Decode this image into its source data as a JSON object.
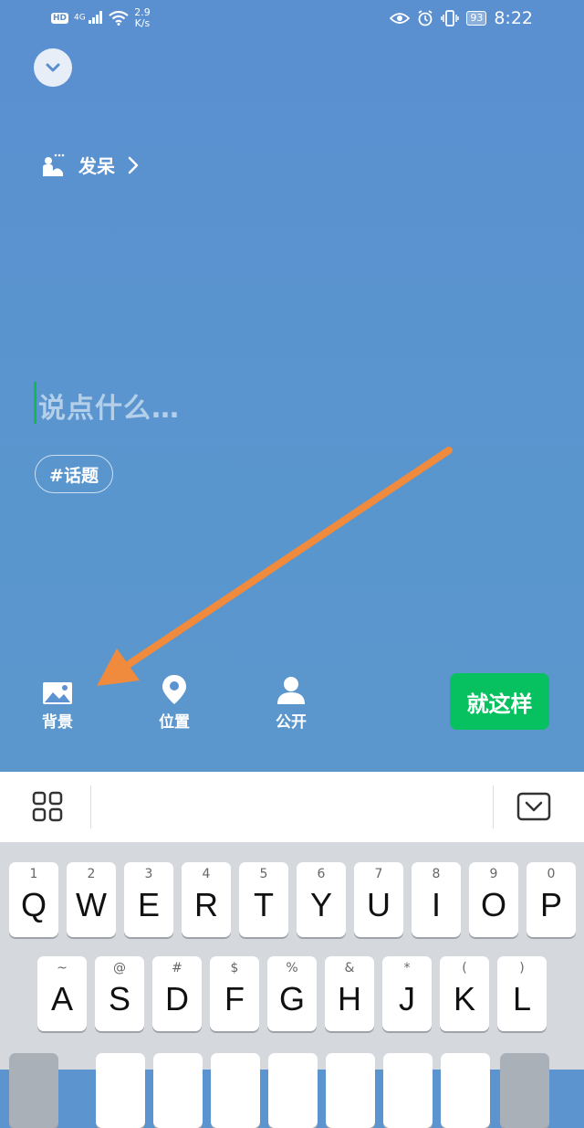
{
  "status_bar": {
    "network_badge": "HD",
    "network_type": "4G",
    "speed_value": "2.9",
    "speed_unit": "K/s",
    "battery": "93",
    "time": "8:22"
  },
  "header": {
    "collapse_icon": "chevron-down-icon"
  },
  "mood": {
    "label": "发呆",
    "icon": "person-daze-icon"
  },
  "composer": {
    "placeholder": "说点什么…",
    "topic_label": "#话题"
  },
  "toolbar": {
    "background_label": "背景",
    "location_label": "位置",
    "visibility_label": "公开",
    "submit_label": "就这样"
  },
  "keyboard": {
    "row1": [
      {
        "sub": "1",
        "main": "Q"
      },
      {
        "sub": "2",
        "main": "W"
      },
      {
        "sub": "3",
        "main": "E"
      },
      {
        "sub": "4",
        "main": "R"
      },
      {
        "sub": "5",
        "main": "T"
      },
      {
        "sub": "6",
        "main": "Y"
      },
      {
        "sub": "7",
        "main": "U"
      },
      {
        "sub": "8",
        "main": "I"
      },
      {
        "sub": "9",
        "main": "O"
      },
      {
        "sub": "0",
        "main": "P"
      }
    ],
    "row2": [
      {
        "sub": "~",
        "main": "A"
      },
      {
        "sub": "@",
        "main": "S"
      },
      {
        "sub": "#",
        "main": "D"
      },
      {
        "sub": "$",
        "main": "F"
      },
      {
        "sub": "%",
        "main": "G"
      },
      {
        "sub": "&",
        "main": "H"
      },
      {
        "sub": "*",
        "main": "J"
      },
      {
        "sub": "(",
        "main": "K"
      },
      {
        "sub": ")",
        "main": "L"
      }
    ]
  },
  "colors": {
    "background": "#5a92cf",
    "submit": "#07c160",
    "caret": "#12b94f",
    "annotation_arrow": "#f08a3c"
  }
}
